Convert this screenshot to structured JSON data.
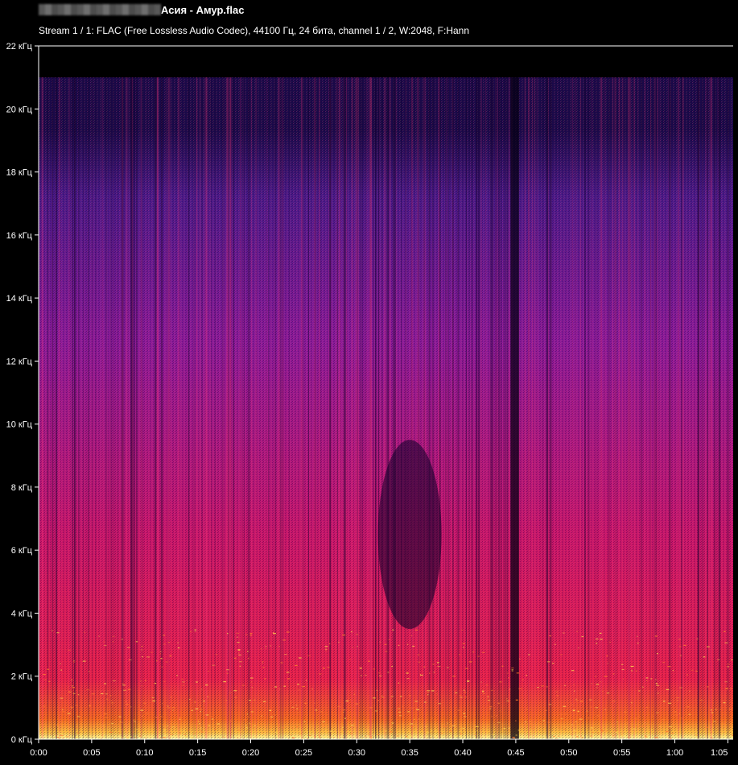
{
  "header": {
    "filename": "Асия - Амур.flac",
    "stream_info": "Stream 1 / 1: FLAC (Free Lossless Audio Codec), 44100 Гц, 24 бита, channel 1 / 2, W:2048, F:Hann"
  },
  "chart_data": {
    "type": "heatmap",
    "title": "",
    "xlabel": "",
    "ylabel": "",
    "x_tick_labels": [
      "0:00",
      "0:05",
      "0:10",
      "0:15",
      "0:20",
      "0:25",
      "0:30",
      "0:35",
      "0:40",
      "0:45",
      "0:50",
      "0:55",
      "1:00",
      "1:05"
    ],
    "x_ticks_seconds": [
      0,
      5,
      10,
      15,
      20,
      25,
      30,
      35,
      40,
      45,
      50,
      55,
      60,
      65
    ],
    "y_tick_labels": [
      "0 кГц",
      "2 кГц",
      "4 кГц",
      "6 кГц",
      "8 кГц",
      "10 кГц",
      "12 кГц",
      "14 кГц",
      "16 кГц",
      "18 кГц",
      "20 кГц",
      "22 кГц"
    ],
    "y_ticks_khz": [
      0,
      2,
      4,
      6,
      8,
      10,
      12,
      14,
      16,
      18,
      20,
      22
    ],
    "xlim": [
      0,
      65.5
    ],
    "ylim": [
      0,
      22
    ],
    "spectral_cutoff_khz": 21,
    "colormap": [
      "#000000",
      "#1a0a4a",
      "#4a1a8a",
      "#8a1a9a",
      "#c8156a",
      "#e8204a",
      "#f86a20",
      "#ffc040",
      "#ffffa0"
    ],
    "quiet_segments_seconds": [
      [
        32,
        38
      ],
      [
        44.5,
        45.3
      ]
    ],
    "grid": false,
    "legend": "none"
  },
  "colors": {
    "background": "#000000",
    "text": "#ffffff",
    "axis": "#ffffff"
  }
}
